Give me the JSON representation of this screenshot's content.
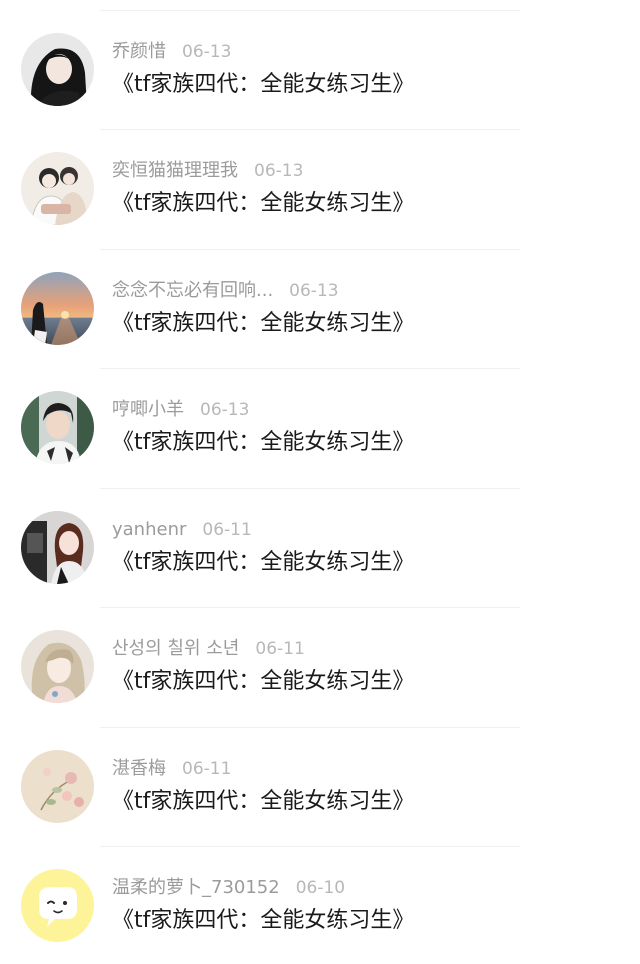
{
  "comments": [
    {
      "user": "乔颜惜",
      "date": "06-13",
      "title": "《tf家族四代：全能女练习生》",
      "avatar": "girl-dark-hair-avatar"
    },
    {
      "user": "奕恒猫猫理理我",
      "date": "06-13",
      "title": "《tf家族四代：全能女练习生》",
      "avatar": "couple-sketch-avatar"
    },
    {
      "user": "念念不忘必有回响...",
      "date": "06-13",
      "title": "《tf家族四代：全能女练习生》",
      "avatar": "sunset-beach-avatar"
    },
    {
      "user": "哼唧小羊",
      "date": "06-13",
      "title": "《tf家族四代：全能女练习生》",
      "avatar": "boy-portrait-avatar"
    },
    {
      "user": "yanhenr",
      "date": "06-11",
      "title": "《tf家族四代：全能女练习生》",
      "avatar": "girl-studio-avatar"
    },
    {
      "user": "산성의 칠위 소년",
      "date": "06-11",
      "title": "《tf家族四代：全能女练习生》",
      "avatar": "blonde-girl-avatar"
    },
    {
      "user": "湛香梅",
      "date": "06-11",
      "title": "《tf家族四代：全能女练习生》",
      "avatar": "flower-beige-avatar"
    },
    {
      "user": "温柔的萝卜_730152",
      "date": "06-10",
      "title": "《tf家族四代：全能女练习生》",
      "avatar": "default-chat-bubble-avatar"
    }
  ]
}
